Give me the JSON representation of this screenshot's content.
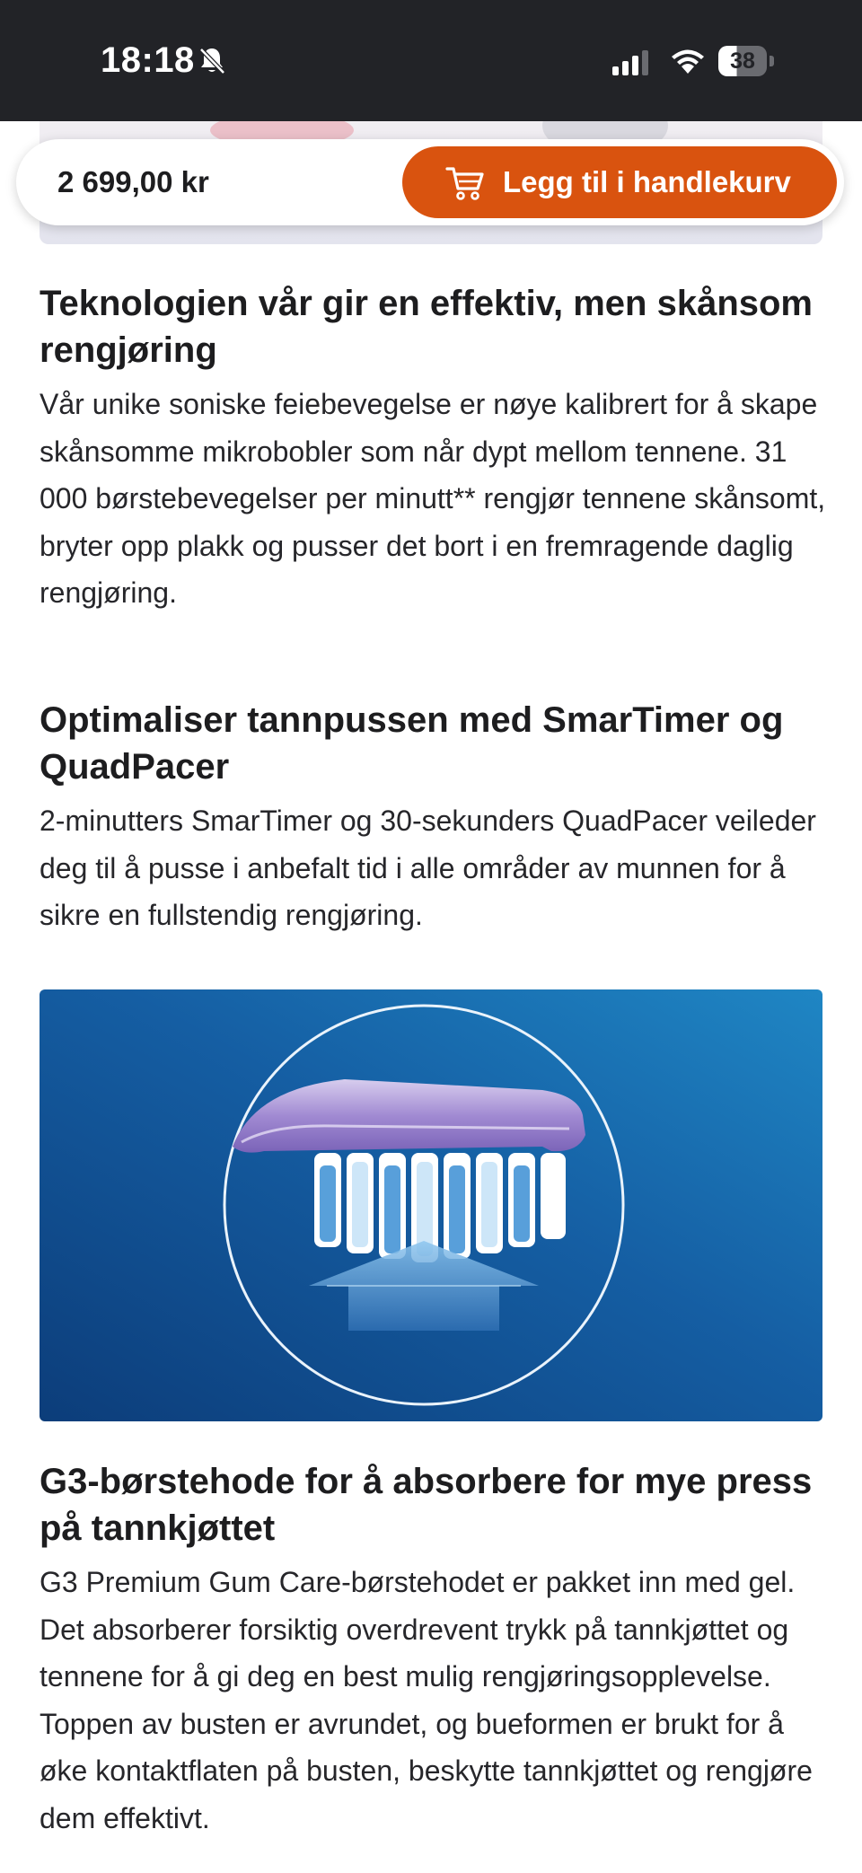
{
  "status_bar": {
    "time": "18:18",
    "battery": "38",
    "icons": [
      "bell-slash-icon",
      "signal-icon",
      "wifi-icon",
      "battery-icon"
    ]
  },
  "purchase_bar": {
    "price": "2 699,00 kr",
    "cart_button_label": "Legg til i handlekurv",
    "cart_button_color": "#d9530f",
    "cart_icon": "shopping-cart-icon"
  },
  "sections": [
    {
      "heading": "Teknologien vår gir en effektiv, men skånsom rengjøring",
      "body": "Vår unike soniske feiebevegelse er nøye kalibrert for å skape skånsomme mikrobobler som når dypt mellom tennene. 31 000 børstebevegelser per minutt** rengjør tennene skånsomt, bryter opp plakk og pusser det bort i en fremragende daglig rengjøring."
    },
    {
      "heading": "Optimaliser tannpussen med SmarTimer og QuadPacer",
      "body": "2-minutters SmarTimer og 30-sekunders QuadPacer veileder deg til å pusse i anbefalt tid i alle områder av munnen for å sikre en fullstendig rengjøring."
    },
    {
      "heading": "G3-børstehode for å absorbere for mye press på tannkjøttet",
      "body": "G3 Premium Gum Care-børstehodet er pakket inn med gel. Det absorberer forsiktig overdrevent trykk på tannkjøttet og tennene for å gi deg en best mulig rengjøringsopplevelse. Toppen av busten er avrundet, og bueformen er brukt for å øke kontaktflaten på busten, beskytte tannkjøttet og rengjøre dem effektivt."
    }
  ]
}
